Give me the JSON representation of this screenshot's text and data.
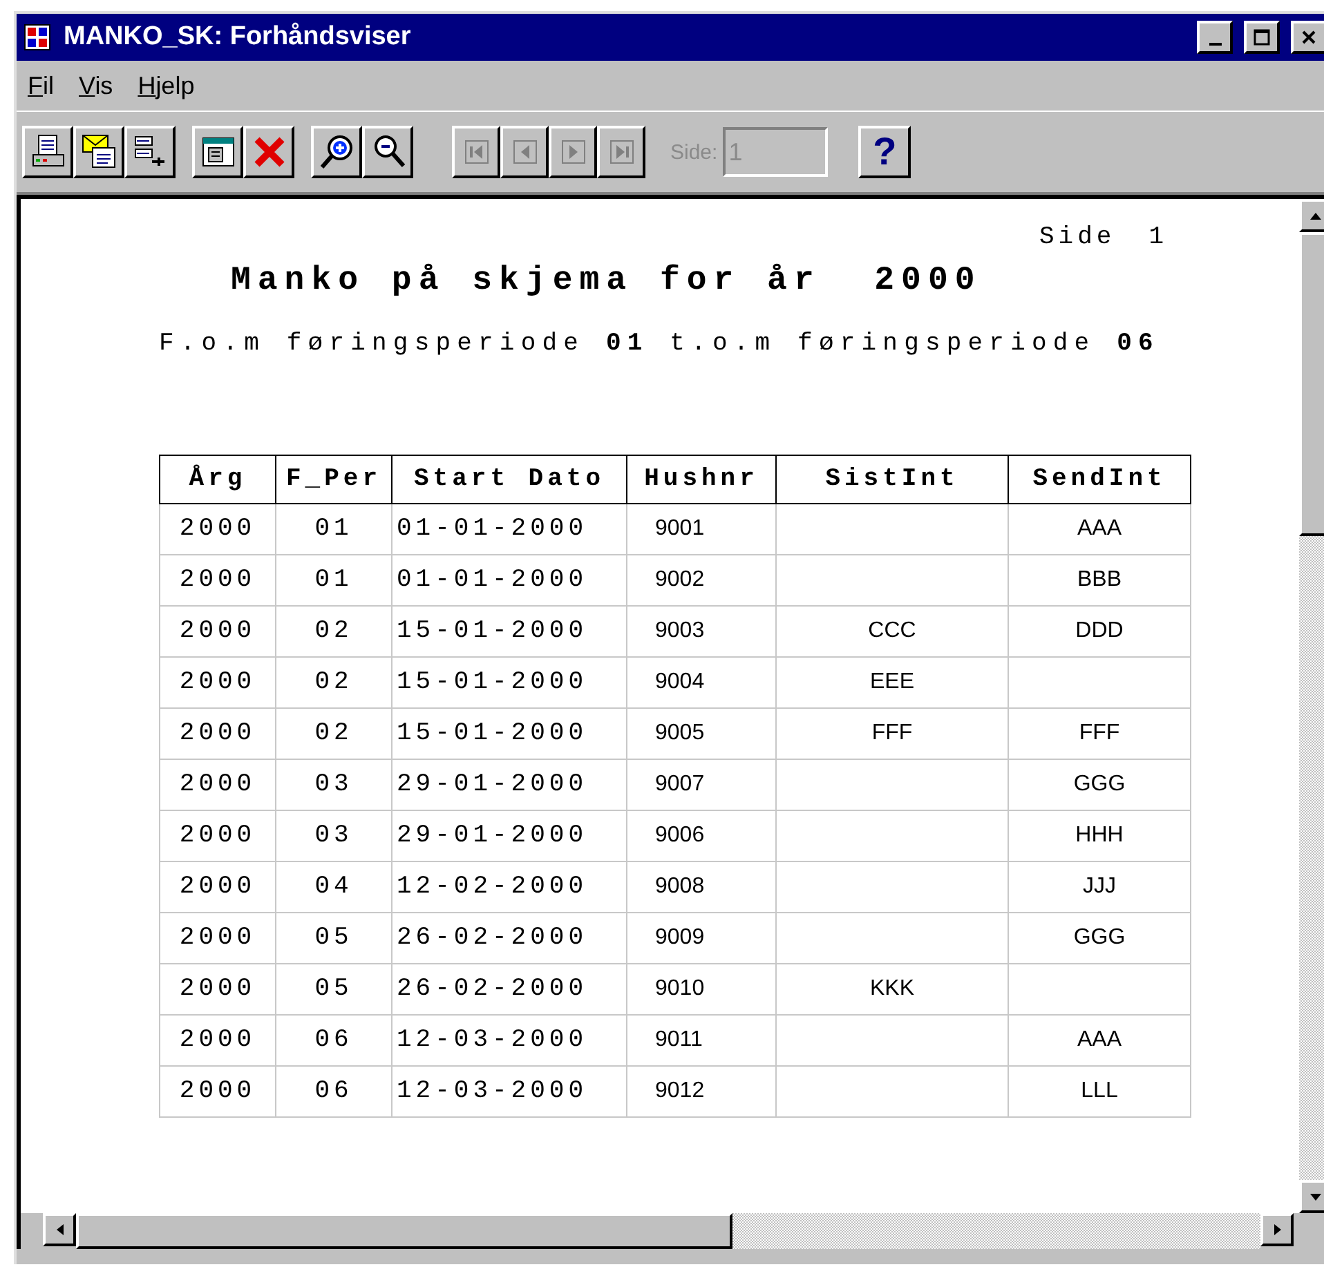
{
  "window": {
    "title": "MANKO_SK: Forhåndsviser"
  },
  "menu": [
    "Fil",
    "Vis",
    "Hjelp"
  ],
  "toolbar": {
    "groups": [
      [
        {
          "kind": "print",
          "disabled": false
        },
        {
          "kind": "mail",
          "disabled": false
        },
        {
          "kind": "setup",
          "disabled": false
        }
      ],
      [
        {
          "kind": "window",
          "disabled": false
        },
        {
          "kind": "close",
          "disabled": false
        }
      ],
      [
        {
          "kind": "zoomin",
          "disabled": false
        },
        {
          "kind": "zoomout",
          "disabled": false
        }
      ],
      [
        {
          "kind": "first",
          "disabled": true
        },
        {
          "kind": "prev",
          "disabled": true
        },
        {
          "kind": "next",
          "disabled": true
        },
        {
          "kind": "last",
          "disabled": true
        }
      ]
    ],
    "page_label": "Side:",
    "page_value": "1",
    "page_disabled": true,
    "help": "?"
  },
  "report": {
    "page_label": "Side",
    "page_number": "1",
    "title": "Manko på skjema for år  2000",
    "subtitle": "F.o.m føringsperiode **01** t.o.m føringsperiode **06**",
    "columns": [
      "Årg",
      "F_Per",
      "Start Dato",
      "Hushnr",
      "SistInt",
      "SendInt"
    ],
    "rows": [
      {
        "year": "2000",
        "period": "01",
        "date": "01-01-2000",
        "house": "9001",
        "send": "AAA"
      },
      {
        "year": "2000",
        "period": "01",
        "date": "01-01-2000",
        "house": "9002",
        "send": "BBB"
      },
      {
        "year": "2000",
        "period": "02",
        "date": "15-01-2000",
        "house": "9003",
        "last": "CCC",
        "send": "DDD"
      },
      {
        "year": "2000",
        "period": "02",
        "date": "15-01-2000",
        "house": "9004",
        "last": "EEE"
      },
      {
        "year": "2000",
        "period": "02",
        "date": "15-01-2000",
        "house": "9005",
        "last": "FFF",
        "send": "FFF"
      },
      {
        "year": "2000",
        "period": "03",
        "date": "29-01-2000",
        "house": "9007",
        "send": "GGG"
      },
      {
        "year": "2000",
        "period": "03",
        "date": "29-01-2000",
        "house": "9006",
        "send": "HHH"
      },
      {
        "year": "2000",
        "period": "04",
        "date": "12-02-2000",
        "house": "9008",
        "send": "JJJ"
      },
      {
        "year": "2000",
        "period": "05",
        "date": "26-02-2000",
        "house": "9009",
        "send": "GGG"
      },
      {
        "year": "2000",
        "period": "05",
        "date": "26-02-2000",
        "house": "9010",
        "last": "KKK"
      },
      {
        "year": "2000",
        "period": "06",
        "date": "12-03-2000",
        "house": "9011",
        "send": "AAA"
      },
      {
        "year": "2000",
        "period": "06",
        "date": "12-03-2000",
        "house": "9012",
        "send": "LLL"
      }
    ]
  }
}
